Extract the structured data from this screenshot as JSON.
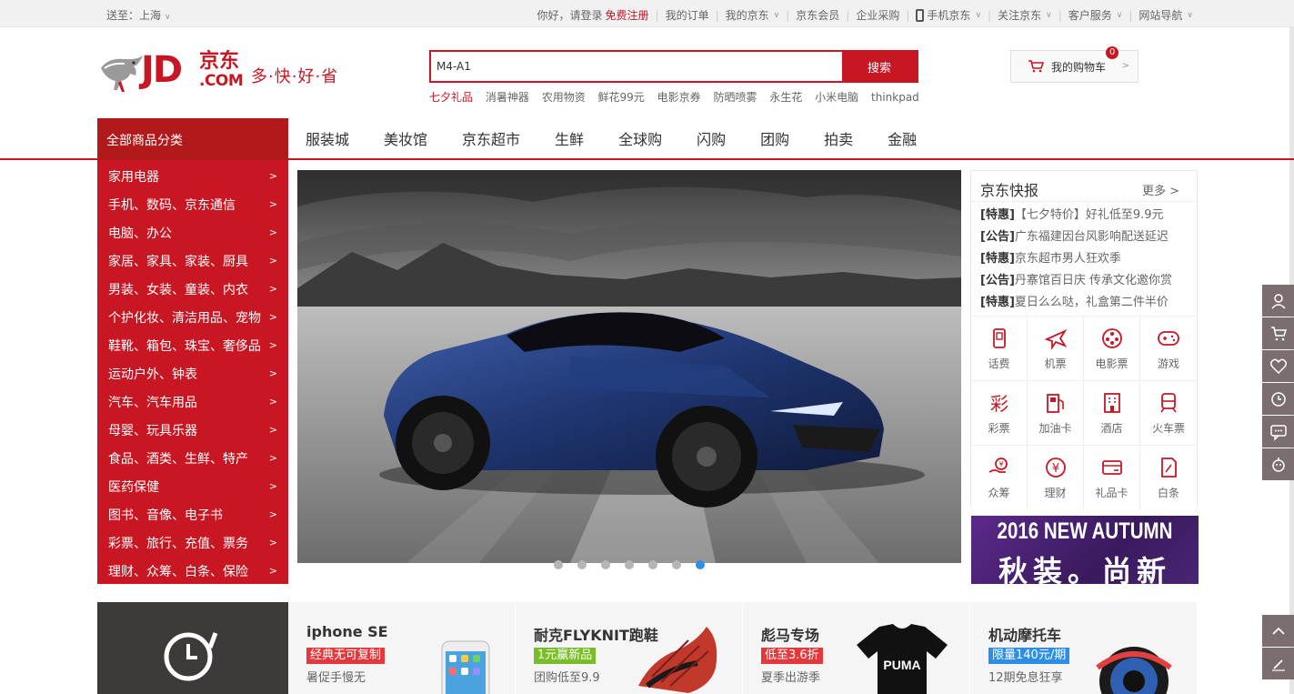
{
  "topbar": {
    "location": "送至：上海",
    "greeting": "你好，请登录",
    "register": "免费注册",
    "links": [
      "我的订单",
      "我的京东",
      "京东会员",
      "企业采购",
      "手机京东",
      "关注京东",
      "客户服务",
      "网站导航"
    ]
  },
  "header": {
    "logo_jd": "JD",
    "logo_cn": "京东",
    "logo_com": ".COM",
    "slogan": "多·快·好·省",
    "search_value": "M4-A1",
    "search_button": "搜索",
    "hotwords": [
      "七夕礼品",
      "消暑神器",
      "农用物资",
      "鲜花99元",
      "电影京券",
      "防晒喷雾",
      "永生花",
      "小米电脑",
      "thinkpad"
    ],
    "cart_label": "我的购物车",
    "cart_count": "0"
  },
  "nav": {
    "all_categories": "全部商品分类",
    "items": [
      "服装城",
      "美妆馆",
      "京东超市",
      "生鲜",
      "全球购",
      "闪购",
      "团购",
      "拍卖",
      "金融"
    ]
  },
  "categories": [
    "家用电器",
    "手机、数码、京东通信",
    "电脑、办公",
    "家居、家具、家装、厨具",
    "男装、女装、童装、内衣",
    "个护化妆、清洁用品、宠物",
    "鞋靴、箱包、珠宝、奢侈品",
    "运动户外、钟表",
    "汽车、汽车用品",
    "母婴、玩具乐器",
    "食品、酒类、生鲜、特产",
    "医药保健",
    "图书、音像、电子书",
    "彩票、旅行、充值、票务",
    "理财、众筹、白条、保险"
  ],
  "category_arrow": ">",
  "carousel": {
    "slides": 7,
    "active": 7
  },
  "news": {
    "title": "京东快报",
    "more": "更多 >",
    "items": [
      {
        "tag": "[特惠]",
        "text": "【七夕特价】好礼低至9.9元"
      },
      {
        "tag": "[公告]",
        "text": "广东福建因台风影响配送延迟"
      },
      {
        "tag": "[特惠]",
        "text": "京东超市男人狂欢季"
      },
      {
        "tag": "[公告]",
        "text": "丹寨馆百日庆 传承文化邀你赏"
      },
      {
        "tag": "[特惠]",
        "text": "夏日么么哒，礼盒第二件半价"
      }
    ]
  },
  "services": [
    {
      "label": "话费",
      "icon": "phone-bill-icon"
    },
    {
      "label": "机票",
      "icon": "plane-icon"
    },
    {
      "label": "电影票",
      "icon": "film-icon"
    },
    {
      "label": "游戏",
      "icon": "gamepad-icon"
    },
    {
      "label": "彩票",
      "icon": "lottery-icon"
    },
    {
      "label": "加油卡",
      "icon": "fuel-icon"
    },
    {
      "label": "酒店",
      "icon": "hotel-icon"
    },
    {
      "label": "火车票",
      "icon": "train-icon"
    },
    {
      "label": "众筹",
      "icon": "crowdfund-icon"
    },
    {
      "label": "理财",
      "icon": "finance-icon"
    },
    {
      "label": "礼品卡",
      "icon": "giftcard-icon"
    },
    {
      "label": "白条",
      "icon": "iou-icon"
    }
  ],
  "autumn_ad": {
    "line1": "2016 NEW AUTUMN",
    "line2": "秋装。尚新"
  },
  "promos": [
    {
      "title": "iphone SE",
      "tag": "经典无可复制",
      "tag_color": "#e4393c",
      "sub": "暑促手慢无"
    },
    {
      "title": "耐克FLYKNIT跑鞋",
      "tag": "1元赢新品",
      "tag_color": "#7abd2a",
      "sub": "团购低至9.9"
    },
    {
      "title": "彪马专场",
      "tag": "低至3.6折",
      "tag_color": "#e4393c",
      "sub": "夏季出游季"
    },
    {
      "title": "机动摩托车",
      "tag": "限量140元/期",
      "tag_color": "#2b8fe8",
      "sub": "12期免息狂享"
    }
  ],
  "colors": {
    "brand_red": "#c81623",
    "dark_red": "#b1191a",
    "tool_gray": "#7a6e6e"
  }
}
